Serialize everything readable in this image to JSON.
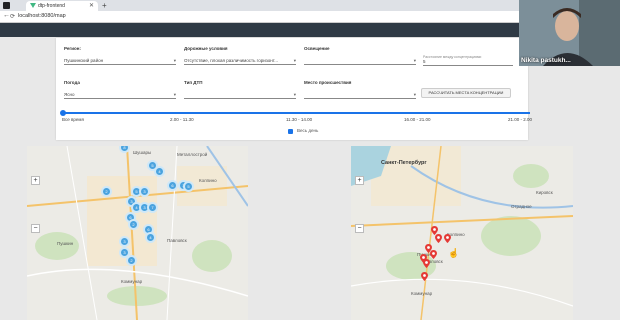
{
  "browser": {
    "tab_title": "dtp-frontend",
    "url": "localhost:8080/map"
  },
  "form": {
    "region": {
      "label": "Регион:",
      "value": "Пушкинский район"
    },
    "road_conditions": {
      "label": "Дорожные условия",
      "value": "Отсутствие, плохая различимость горизонт..."
    },
    "lighting": {
      "label": "Освещение",
      "value": ""
    },
    "radius": {
      "label": "Расстояние между концентрациями",
      "value": "5"
    },
    "weather": {
      "label": "Погода",
      "value": "Ясно"
    },
    "accident_type": {
      "label": "Тип ДТП",
      "value": ""
    },
    "place": {
      "label": "Место происшествия",
      "value": ""
    },
    "calc_button": "РАССЧИТАТЬ МЕСТА КОНЦЕНТРАЦИИ",
    "time_ticks": [
      "Все время",
      "2.00 - 11.30",
      "11.30 - 14.00",
      "16.00 - 21.00",
      "21.00 - 2.00"
    ],
    "all_day_label": "Весь день",
    "all_day_checked": true
  },
  "map_left": {
    "labels": [
      "Колпино",
      "Пушкин",
      "Коммунар",
      "Павловск",
      "Металлострой",
      "Шушары"
    ],
    "clusters": [
      "8",
      "5",
      "4",
      "2",
      "5",
      "3",
      "3",
      "6",
      "3",
      "5",
      "4",
      "3",
      "6",
      "7",
      "2",
      "6",
      "3",
      "4",
      "3",
      "2"
    ]
  },
  "map_right": {
    "labels": [
      "Санкт-Петербург",
      "Колпино",
      "Пушкин",
      "Павловск",
      "Коммунар",
      "Кировск",
      "Отрадное"
    ]
  },
  "webcam": {
    "name": "Nikita pastukh..."
  },
  "colors": {
    "accent": "#1a73e8",
    "cluster": "#4aa3df",
    "pin": "#e53935",
    "appbar": "#2f3a45"
  }
}
